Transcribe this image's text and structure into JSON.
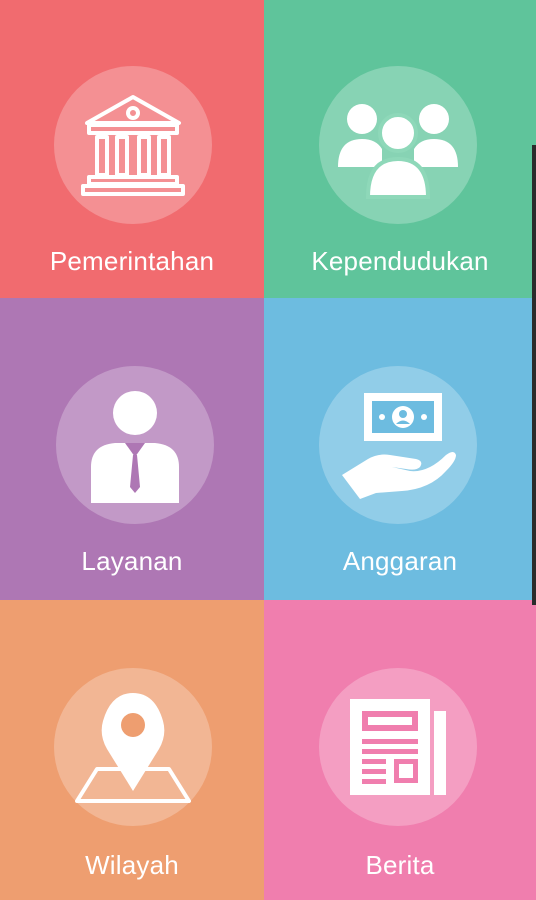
{
  "menu": {
    "items": [
      {
        "label": "Pemerintahan",
        "icon": "government-building-icon",
        "color": "#F16B6F"
      },
      {
        "label": "Kependudukan",
        "icon": "people-group-icon",
        "color": "#5FC49B"
      },
      {
        "label": "Layanan",
        "icon": "officer-person-icon",
        "color": "#AE77B4"
      },
      {
        "label": "Anggaran",
        "icon": "money-hand-icon",
        "color": "#6DBCE0"
      },
      {
        "label": "Wilayah",
        "icon": "map-pin-icon",
        "color": "#EE9E70"
      },
      {
        "label": "Berita",
        "icon": "newspaper-icon",
        "color": "#F07EAE"
      }
    ]
  }
}
